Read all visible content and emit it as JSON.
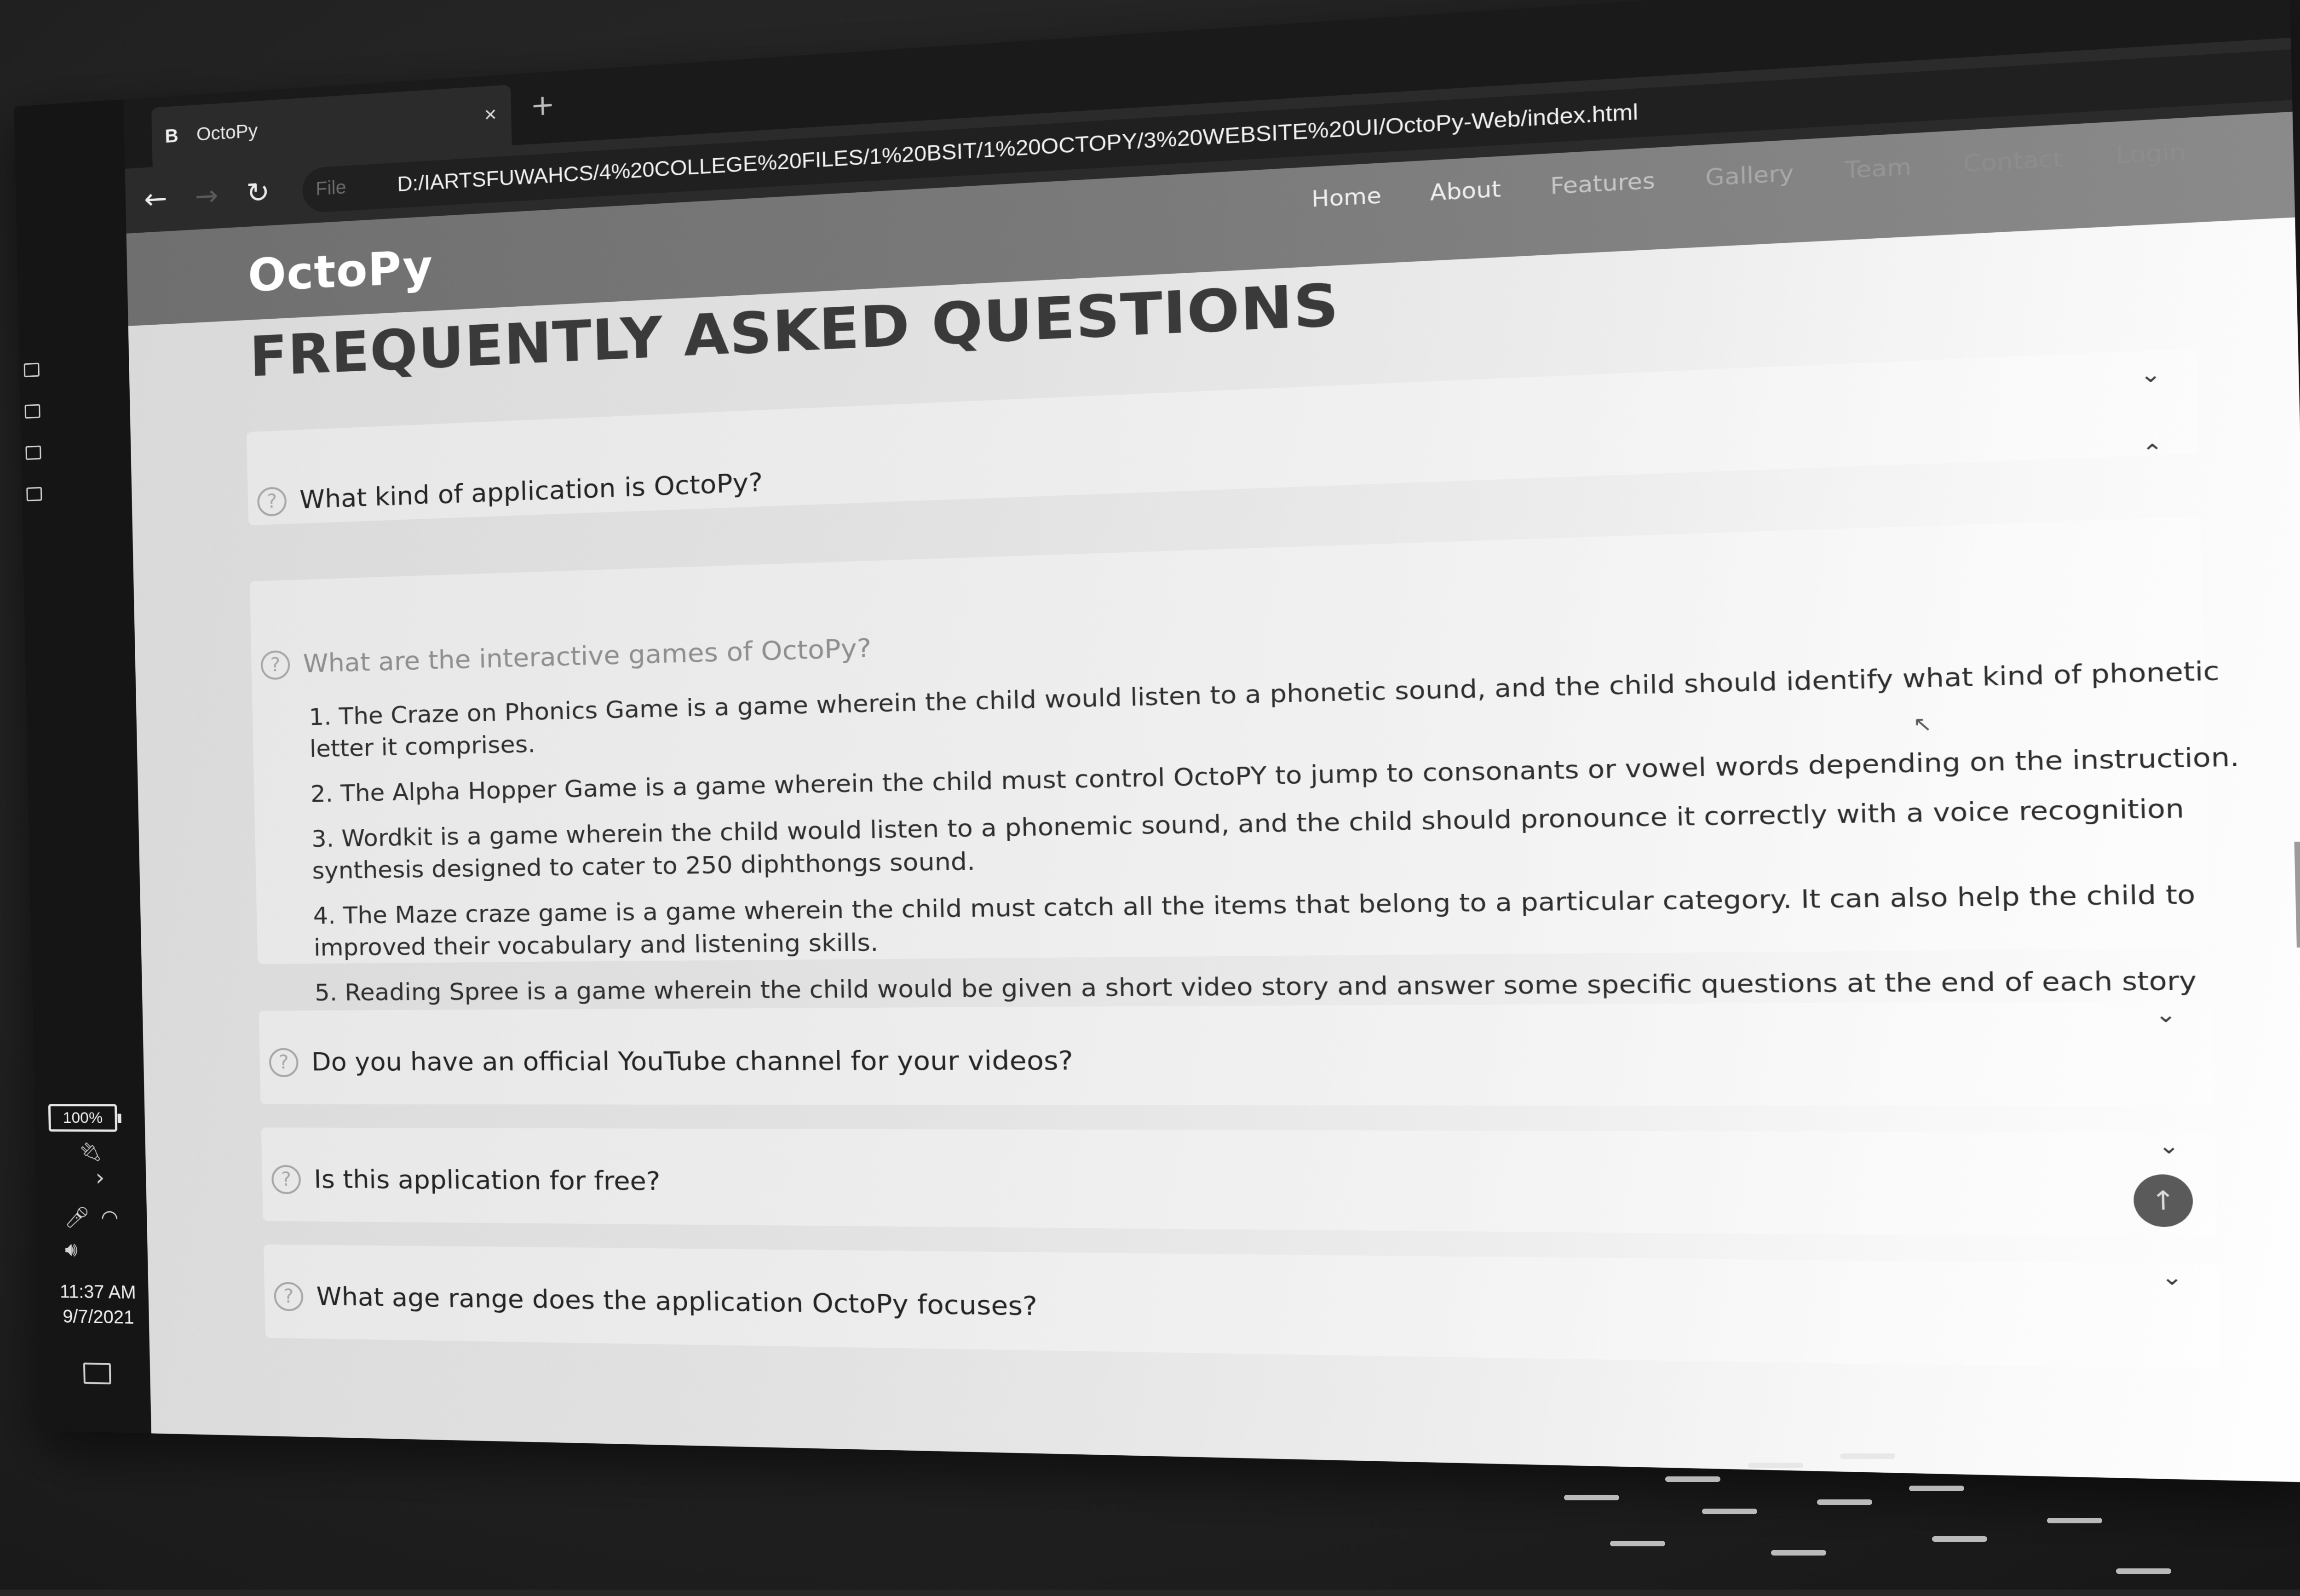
{
  "taskbar": {
    "battery": "100%",
    "clock_time": "11:37 AM",
    "clock_date": "9/7/2021"
  },
  "browser": {
    "tab_favicon": "B",
    "tab_title": "OctoPy",
    "close_glyph": "×",
    "new_tab_glyph": "+",
    "back_glyph": "←",
    "forward_glyph": "→",
    "reload_glyph": "↻",
    "url_info": "File",
    "url": "D:/IARTSFUWAHCS/4%20COLLEGE%20FILES/1%20BSIT/1%20OCTOPY/3%20WEBSITE%20UI/OctoPy-Web/index.html"
  },
  "site": {
    "logo": "OctoPy",
    "nav": [
      "Home",
      "About",
      "Features",
      "Gallery",
      "Team",
      "Contact",
      "Login"
    ]
  },
  "faq": {
    "heading": "FREQUENTLY ASKED QUESTIONS",
    "q_icon": "?",
    "chevron_down": "⌄",
    "chevron_up": "⌃",
    "items": [
      {
        "question": "What kind of application is OctoPy?"
      },
      {
        "question": "What are the interactive games of OctoPy?"
      },
      {
        "question": "Do you have an official YouTube channel for your videos?"
      },
      {
        "question": "Is this application for free?"
      },
      {
        "question": "What age range does the application OctoPy focuses?"
      }
    ],
    "answer_lines": [
      "1. The Craze on Phonics Game is a game wherein the child would listen to a phonetic sound, and the child should identify what kind of phonetic letter it comprises.",
      "2. The Alpha Hopper Game is a game wherein the child must control OctoPY to jump to consonants or vowel words depending on the instruction.",
      "3. Wordkit is a game wherein the child would listen to a phonemic sound, and the child should pronounce it correctly with a voice recognition synthesis designed to cater to 250 diphthongs sound.",
      "4. The Maze craze game is a game wherein the child must catch all the items that belong to a particular category. It can also help the child to improved their vocabulary and listening skills.",
      "5. Reading Spree is a game wherein the child would be given a short video story and answer some specific questions at the end of each story"
    ]
  },
  "scroll_top_glyph": "↑"
}
